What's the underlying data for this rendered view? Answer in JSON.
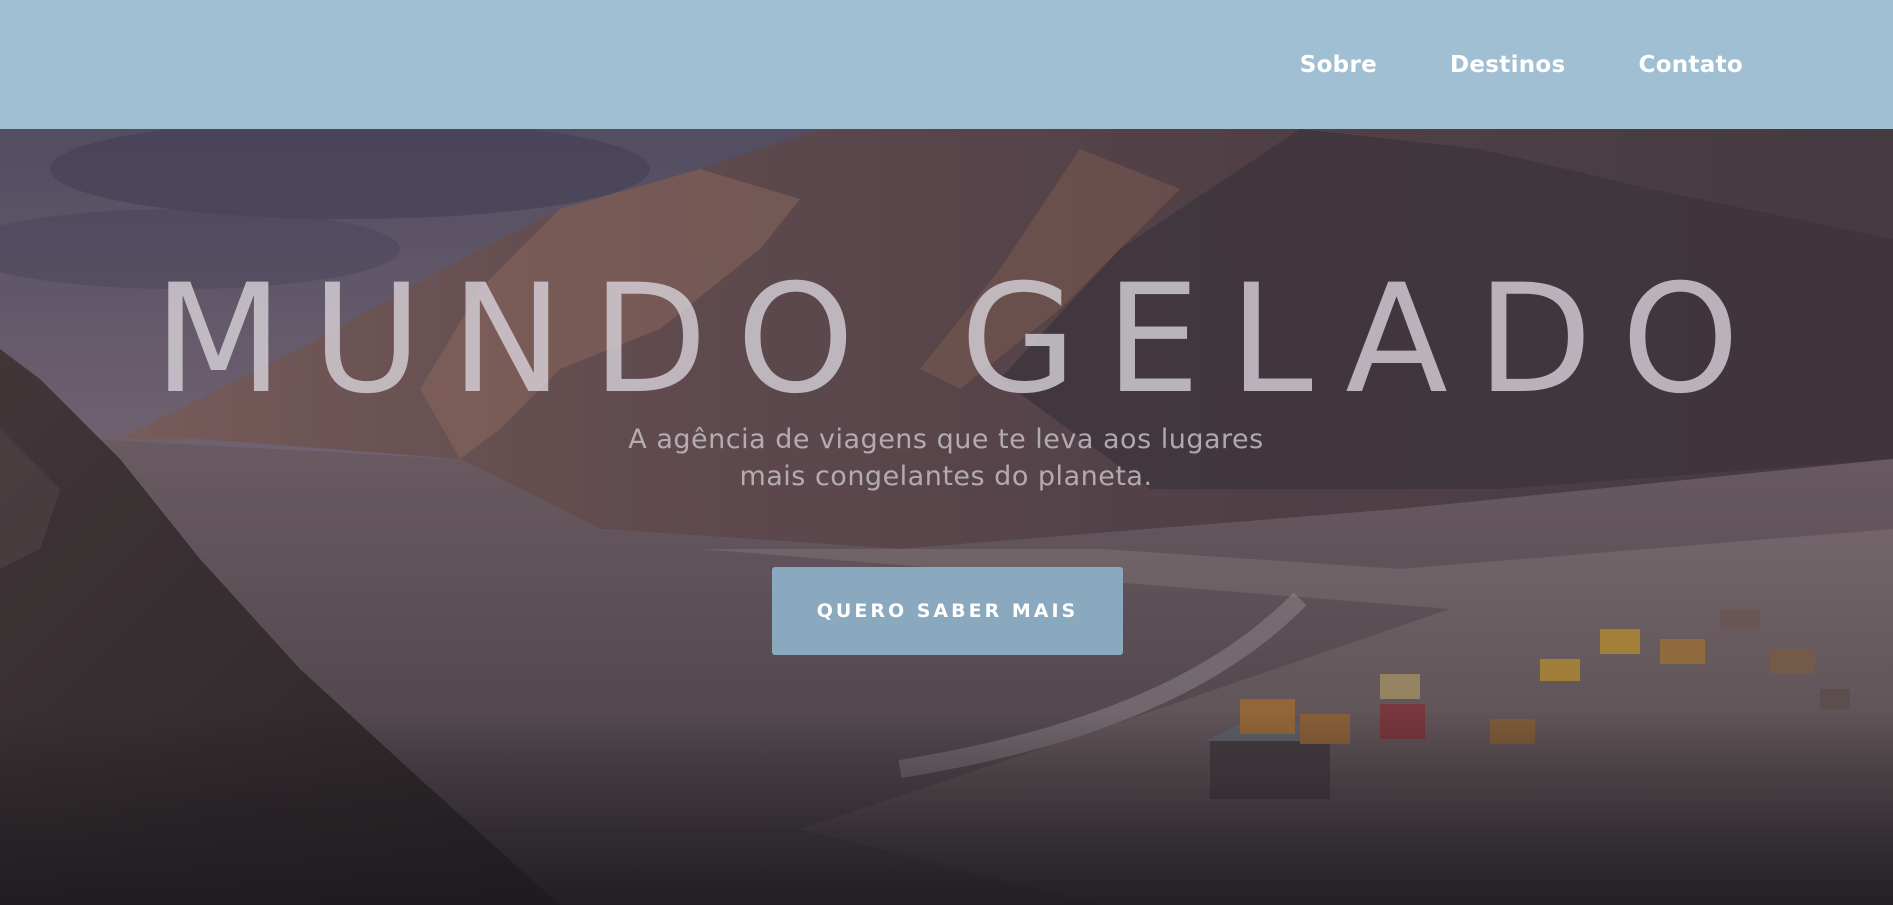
{
  "nav": {
    "items": [
      {
        "label": "Sobre"
      },
      {
        "label": "Destinos"
      },
      {
        "label": "Contato"
      }
    ]
  },
  "hero": {
    "title": "MUNDO GELADO",
    "subtitle_line1": "A agência de viagens que te leva aos lugares",
    "subtitle_line2": "mais congelantes do planeta.",
    "cta_label": "QUERO SABER MAIS",
    "background_image": "mountain-lake-village"
  },
  "colors": {
    "navbar": "#a0bfd2",
    "cta": "#8aa8be",
    "nav_text": "#ffffff"
  }
}
